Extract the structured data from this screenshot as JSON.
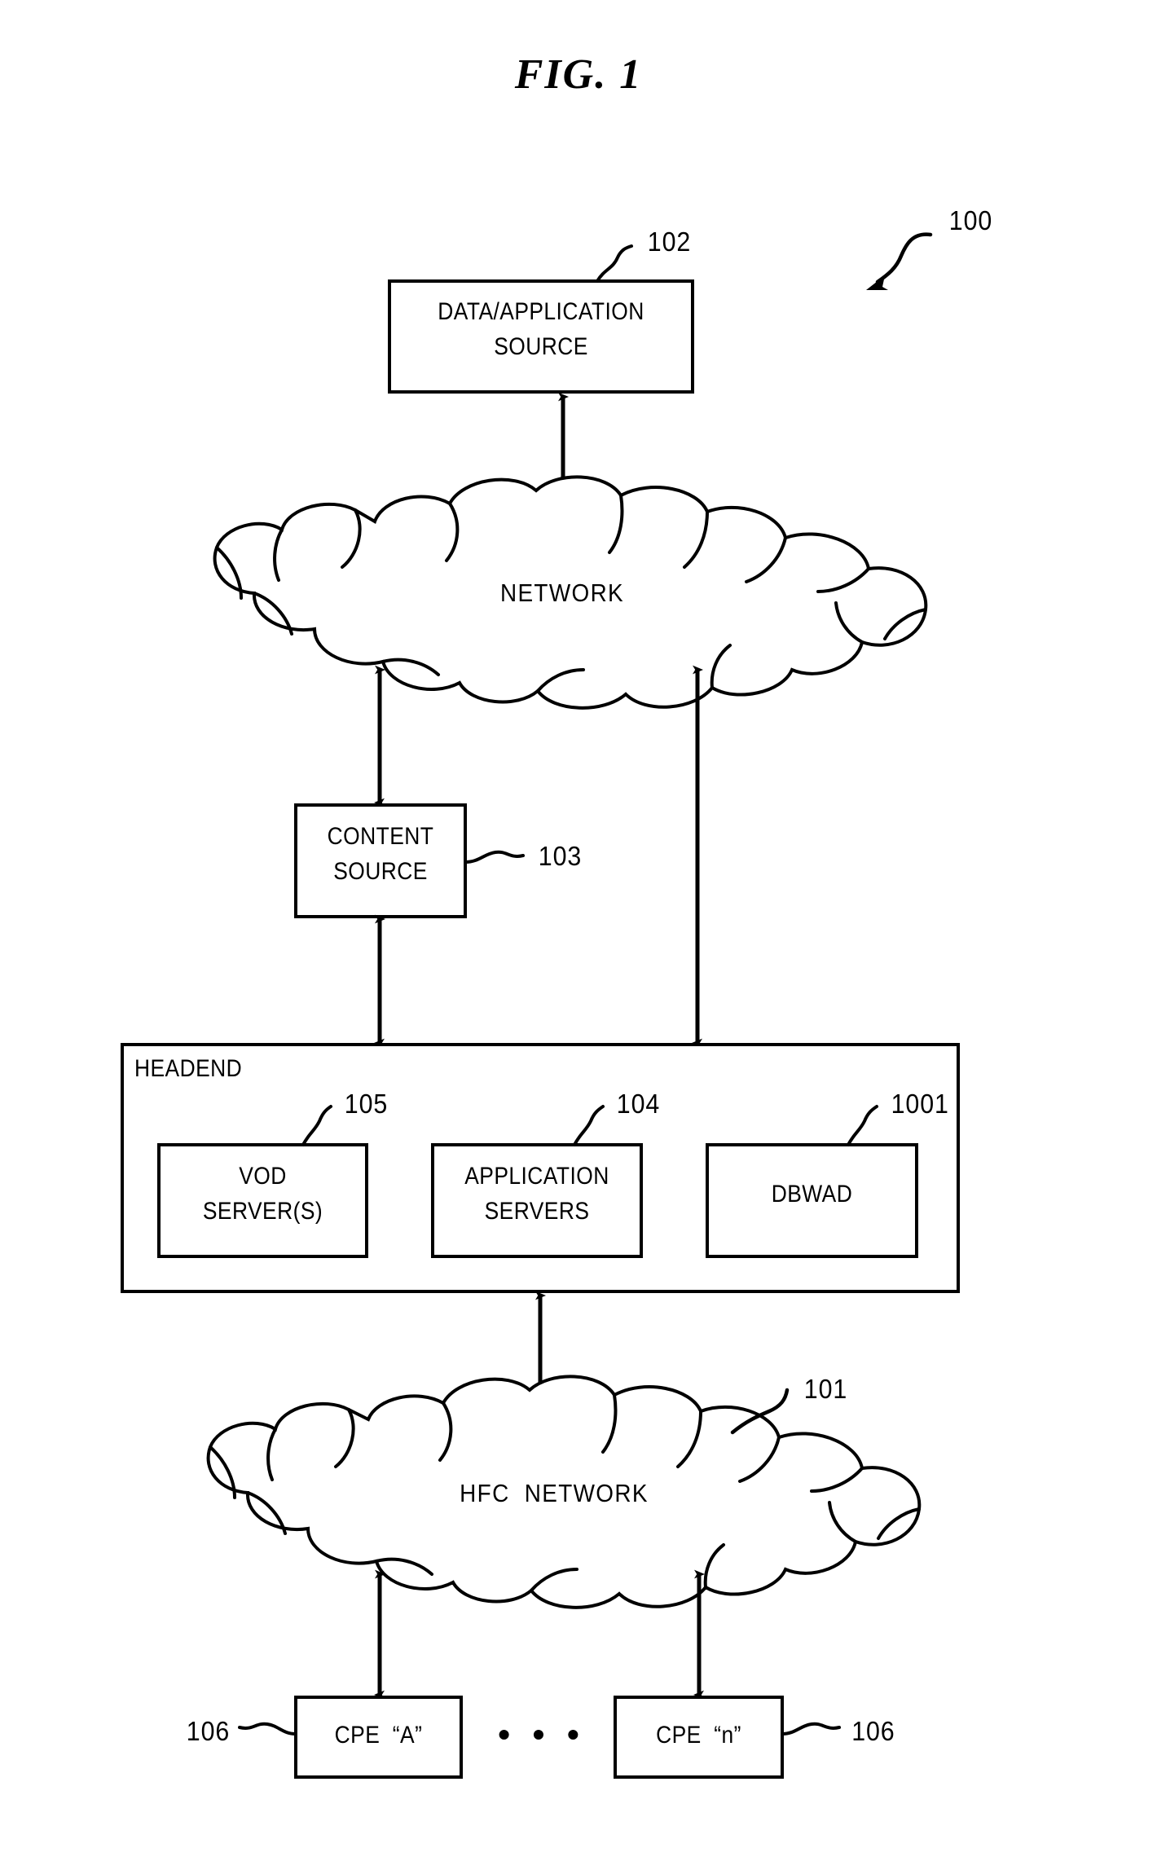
{
  "figure": {
    "title": "FIG.  1",
    "overall_ref": "100"
  },
  "nodes": {
    "data_app_source": {
      "line1": "DATA/APPLICATION",
      "line2": "SOURCE",
      "ref": "102"
    },
    "network_cloud": {
      "label": "NETWORK"
    },
    "content_source": {
      "line1": "CONTENT",
      "line2": "SOURCE",
      "ref": "103"
    },
    "headend": {
      "label": "HEADEND",
      "children": [
        {
          "line1": "VOD",
          "line2": "SERVER(S)",
          "ref": "105"
        },
        {
          "line1": "APPLICATION",
          "line2": "SERVERS",
          "ref": "104"
        },
        {
          "line1": "DBWAD",
          "line2": "",
          "ref": "1001"
        }
      ]
    },
    "hfc_cloud": {
      "label": "HFC  NETWORK",
      "ref": "101"
    },
    "cpe_a": {
      "label": "CPE  “A”",
      "ref": "106"
    },
    "cpe_n": {
      "label": "CPE  “n”",
      "ref": "106"
    },
    "ellipsis": "• • •"
  },
  "colors": {
    "ink": "#000000",
    "paper": "#ffffff"
  }
}
